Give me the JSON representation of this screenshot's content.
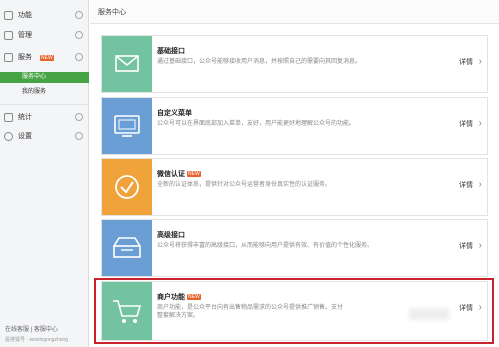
{
  "sidebar": {
    "items": [
      {
        "label": "功能"
      },
      {
        "label": "管理"
      },
      {
        "label": "服务",
        "badge": "NEW"
      },
      {
        "label": "统计"
      },
      {
        "label": "设置"
      }
    ],
    "sub_items": [
      {
        "label": "服务中心",
        "active": true
      },
      {
        "label": "我的服务",
        "active": false
      }
    ],
    "footer": {
      "links": "在线客服 | 客服中心",
      "watermark": "投搜狐号 · weixingongzhong"
    }
  },
  "header": {
    "title": "服务中心"
  },
  "cards": [
    {
      "title": "基础接口",
      "desc": "通过基础接口，公众号能够接收用户消息，并按照自己的需要向其回复消息。",
      "desc2": "",
      "detail": "详情",
      "icon": "mail-icon",
      "color": "#74c3a0",
      "tag": ""
    },
    {
      "title": "自定义菜单",
      "desc": "公众号可以在界面底部加入菜单，友好，用户能更好地理解公众号的功能。",
      "desc2": "",
      "detail": "详情",
      "icon": "monitor-icon",
      "color": "#6a9ed4",
      "tag": ""
    },
    {
      "title": "微信认证",
      "desc": "全新的认证体系，提供针对公众号运营者身份真实性的认证服务。",
      "desc2": "",
      "detail": "详情",
      "icon": "check-icon",
      "color": "#f0a33a",
      "tag": "NEW"
    },
    {
      "title": "高级接口",
      "desc": "公众号将获得丰富的高级接口，从而能够向用户提供有效、有价值的个性化服务。",
      "desc2": "",
      "detail": "详情",
      "icon": "tray-icon",
      "color": "#6a9ed4",
      "tag": ""
    },
    {
      "title": "商户功能",
      "desc": "商户功能，是公众平台向有出售物品需求的公众号提供推广销售。支付",
      "desc2": "整套解决方案。",
      "detail": "详情",
      "icon": "cart-icon",
      "color": "#74c3a0",
      "tag": "NEW"
    }
  ]
}
